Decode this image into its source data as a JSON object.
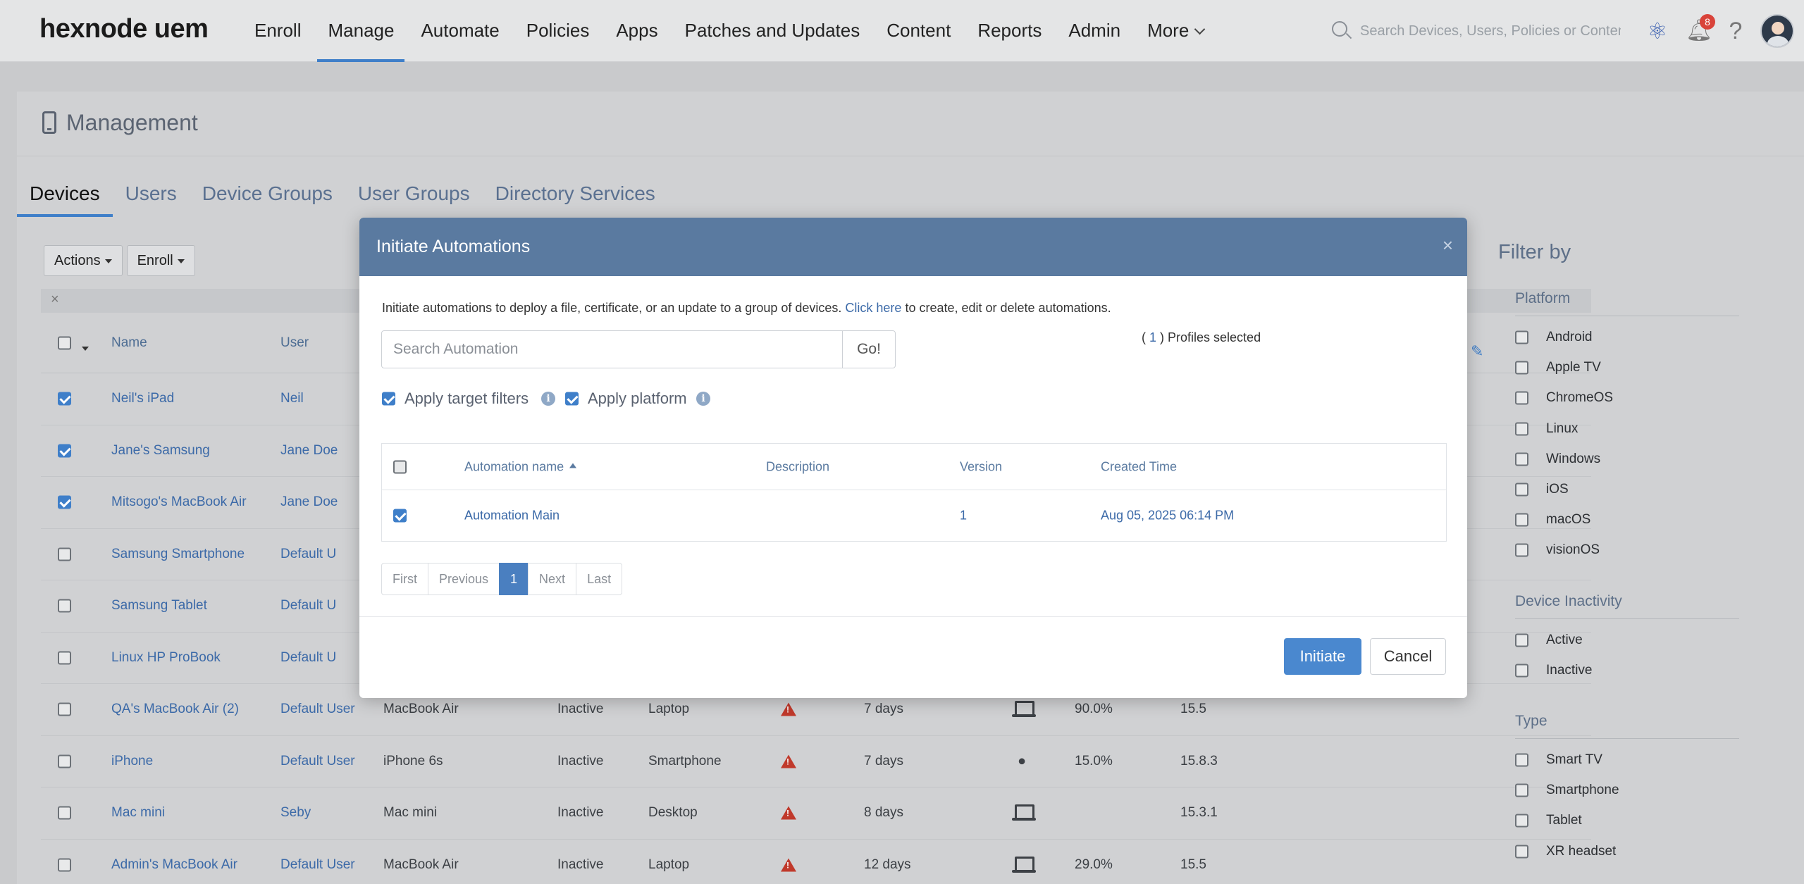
{
  "topnav": {
    "logo": "hexnode uem",
    "items": [
      "Enroll",
      "Manage",
      "Automate",
      "Policies",
      "Apps",
      "Patches and Updates",
      "Content",
      "Reports",
      "Admin",
      "More"
    ],
    "active": "Manage",
    "search_placeholder": "Search Devices, Users, Policies or Content",
    "notification_count": "8"
  },
  "page": {
    "title": "Management",
    "tabs": [
      "Devices",
      "Users",
      "Device Groups",
      "User Groups",
      "Directory Services"
    ],
    "active_tab": "Devices",
    "actions_label": "Actions",
    "enroll_label": "Enroll"
  },
  "device_table": {
    "headers": {
      "name": "Name",
      "user": "User"
    },
    "rows": [
      {
        "checked": true,
        "name": "Neil's iPad",
        "user": "Neil",
        "model": "",
        "status": "",
        "type": "",
        "warning": false,
        "inactive": "",
        "os_icon": "",
        "battery": "",
        "version": ""
      },
      {
        "checked": true,
        "name": "Jane's Samsung",
        "user": "Jane Doe",
        "model": "",
        "status": "",
        "type": "",
        "warning": false,
        "inactive": "",
        "os_icon": "",
        "battery": "",
        "version": ""
      },
      {
        "checked": true,
        "name": "Mitsogo's MacBook Air",
        "user": "Jane Doe",
        "model": "",
        "status": "",
        "type": "",
        "warning": false,
        "inactive": "",
        "os_icon": "",
        "battery": "",
        "version": ""
      },
      {
        "checked": false,
        "name": "Samsung Smartphone",
        "user": "Default U",
        "model": "",
        "status": "",
        "type": "",
        "warning": false,
        "inactive": "",
        "os_icon": "",
        "battery": "",
        "version": ""
      },
      {
        "checked": false,
        "name": "Samsung Tablet",
        "user": "Default U",
        "model": "",
        "status": "",
        "type": "",
        "warning": false,
        "inactive": "",
        "os_icon": "",
        "battery": "",
        "version": ""
      },
      {
        "checked": false,
        "name": "Linux HP ProBook",
        "user": "Default U",
        "model": "",
        "status": "",
        "type": "",
        "warning": false,
        "inactive": "",
        "os_icon": "",
        "battery": "",
        "version": ""
      },
      {
        "checked": false,
        "name": "QA's MacBook Air (2)",
        "user": "Default User",
        "model": "MacBook Air",
        "status": "Inactive",
        "type": "Laptop",
        "warning": true,
        "inactive": "7 days",
        "os_icon": "laptop",
        "battery": "90.0%",
        "version": "15.5"
      },
      {
        "checked": false,
        "name": "iPhone",
        "user": "Default User",
        "model": "iPhone 6s",
        "status": "Inactive",
        "type": "Smartphone",
        "warning": true,
        "inactive": "7 days",
        "os_icon": "apple",
        "battery": "15.0%",
        "version": "15.8.3"
      },
      {
        "checked": false,
        "name": "Mac mini",
        "user": "Seby",
        "model": "Mac mini",
        "status": "Inactive",
        "type": "Desktop",
        "warning": true,
        "inactive": "8 days",
        "os_icon": "laptop",
        "battery": "",
        "version": "15.3.1"
      },
      {
        "checked": false,
        "name": "Admin's MacBook Air",
        "user": "Default User",
        "model": "MacBook Air",
        "status": "Inactive",
        "type": "Laptop",
        "warning": true,
        "inactive": "12 days",
        "os_icon": "laptop",
        "battery": "29.0%",
        "version": "15.5"
      }
    ]
  },
  "filter": {
    "title": "Filter by",
    "groups": [
      {
        "title": "Platform",
        "items": [
          "Android",
          "Apple TV",
          "ChromeOS",
          "Linux",
          "Windows",
          "iOS",
          "macOS",
          "visionOS"
        ]
      },
      {
        "title": "Device Inactivity",
        "items": [
          "Active",
          "Inactive"
        ]
      },
      {
        "title": "Type",
        "items": [
          "Smart TV",
          "Smartphone",
          "Tablet",
          "XR headset"
        ]
      }
    ]
  },
  "modal": {
    "title": "Initiate Automations",
    "desc_before": "Initiate automations to deploy a file, certificate, or an update to a group of devices. ",
    "desc_link": "Click here",
    "desc_after": " to create, edit or delete automations.",
    "search_placeholder": "Search Automation",
    "go_label": "Go!",
    "profiles_open": "( ",
    "profiles_count": "1",
    "profiles_close": " ) Profiles selected",
    "apply_target_filters": "Apply target filters",
    "apply_platform": "Apply platform",
    "table": {
      "headers": [
        "Automation name",
        "Description",
        "Version",
        "Created Time"
      ],
      "rows": [
        {
          "checked": true,
          "name": "Automation Main",
          "description": "",
          "version": "1",
          "created": "Aug 05, 2025 06:14 PM"
        }
      ]
    },
    "pager": [
      "First",
      "Previous",
      "1",
      "Next",
      "Last"
    ],
    "pager_active": "1",
    "initiate_label": "Initiate",
    "cancel_label": "Cancel"
  }
}
